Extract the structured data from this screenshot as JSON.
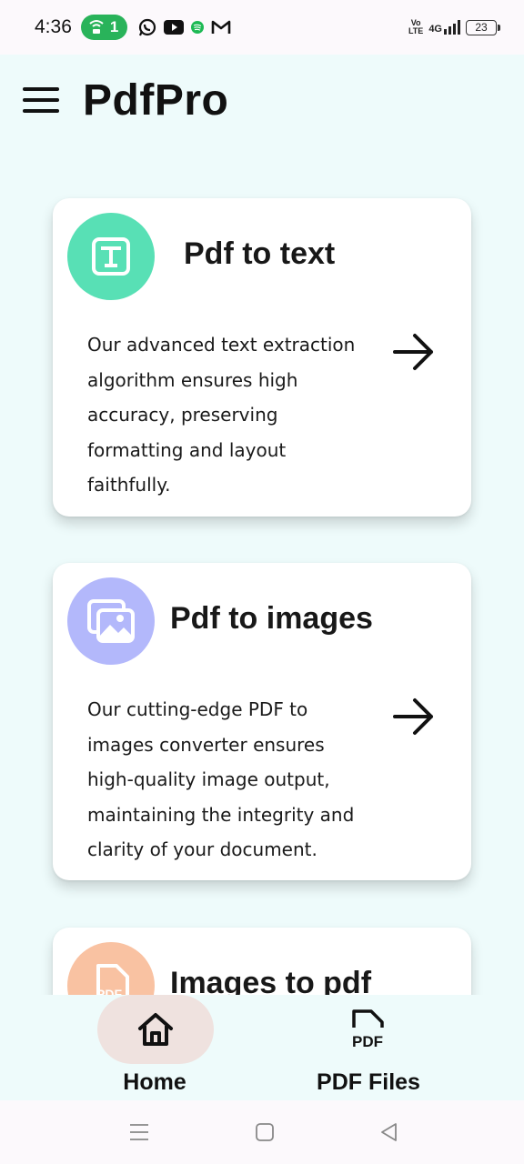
{
  "status_bar": {
    "time": "4:36",
    "hotspot_count": "1",
    "battery": "23",
    "network_type": "4G",
    "volte_top": "Vo",
    "volte_bottom": "LTE",
    "icons": [
      "whatsapp-icon",
      "youtube-icon",
      "spotify-icon",
      "gmail-icon"
    ],
    "hotspot_color": "#29b35a"
  },
  "app_bar": {
    "title": "PdfPro"
  },
  "cards": [
    {
      "title": "Pdf to text",
      "description": "Our advanced text extraction algorithm ensures high accuracy, preserving formatting and layout faithfully.",
      "icon": "text-icon",
      "color": "#58e0b5"
    },
    {
      "title": "Pdf to images",
      "description": "Our cutting-edge PDF to images converter ensures high-quality image output, maintaining the integrity and clarity of your document.",
      "icon": "images-icon",
      "color": "#b3b8fb"
    },
    {
      "title": "Images to pdf",
      "icon": "pdf-file-icon",
      "color": "#f9c2a2"
    }
  ],
  "bottom_nav": {
    "items": [
      {
        "label": "Home",
        "icon": "home-icon",
        "active": true
      },
      {
        "label": "PDF Files",
        "icon": "pdf-file-icon",
        "active": false
      }
    ],
    "pdf_icon_text": "PDF",
    "active_color": "#efe2df"
  },
  "system_nav": [
    "recents-button",
    "home-button",
    "back-button"
  ]
}
